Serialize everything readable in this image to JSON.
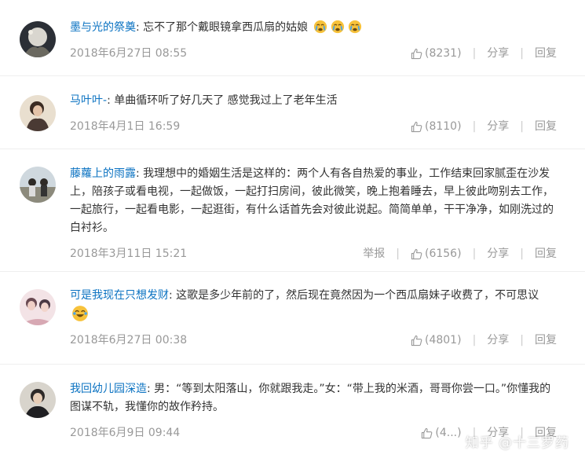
{
  "comments": [
    {
      "username": "墨与光的祭奠",
      "text": "忘不了那个戴眼镜拿西瓜扇的姑娘",
      "emoji_count": 3,
      "time": "2018年6月27日 08:55",
      "likes": "(8231)",
      "share": "分享",
      "reply": "回复"
    },
    {
      "username": "马叶叶-",
      "text": "单曲循环听了好几天了 感觉我过上了老年生活",
      "time": "2018年4月1日 16:59",
      "likes": "(8110)",
      "share": "分享",
      "reply": "回复"
    },
    {
      "username": "藤蘿上的雨露",
      "text": "我理想中的婚姻生活是这样的：两个人有各自热爱的事业，工作结束回家腻歪在沙发上，陪孩子或看电视，一起做饭，一起打扫房间，彼此微笑，晚上抱着睡去，早上彼此吻别去工作，一起旅行，一起看电影，一起逛街，有什么话首先会对彼此说起。简简单单，干干净净，如刚洗过的白衬衫。",
      "time": "2018年3月11日 15:21",
      "report": "举报",
      "likes": "(6156)",
      "share": "分享",
      "reply": "回复"
    },
    {
      "username": "可是我现在只想发财",
      "text": "这歌是多少年前的了，然后现在竟然因为一个西瓜扇妹子收费了，不可思议",
      "emoji_count": 1,
      "time": "2018年6月27日 00:38",
      "likes": "(4801)",
      "share": "分享",
      "reply": "回复"
    },
    {
      "username": "我回幼儿园深造",
      "text": "男：“等到太阳落山，你就跟我走。”女：“带上我的米酒，哥哥你尝一口。”你懂我的图谋不轨，我懂你的故作矜持。",
      "time": "2018年6月9日 09:44",
      "likes": "(4...)",
      "share": "分享",
      "reply": "回复"
    }
  ],
  "watermark": "知乎 @十三罗药",
  "colors": {
    "username": "#0c73c2",
    "text": "#333333",
    "meta": "#999999",
    "divider": "#eeeeee",
    "emoji": "#f7c23b"
  }
}
